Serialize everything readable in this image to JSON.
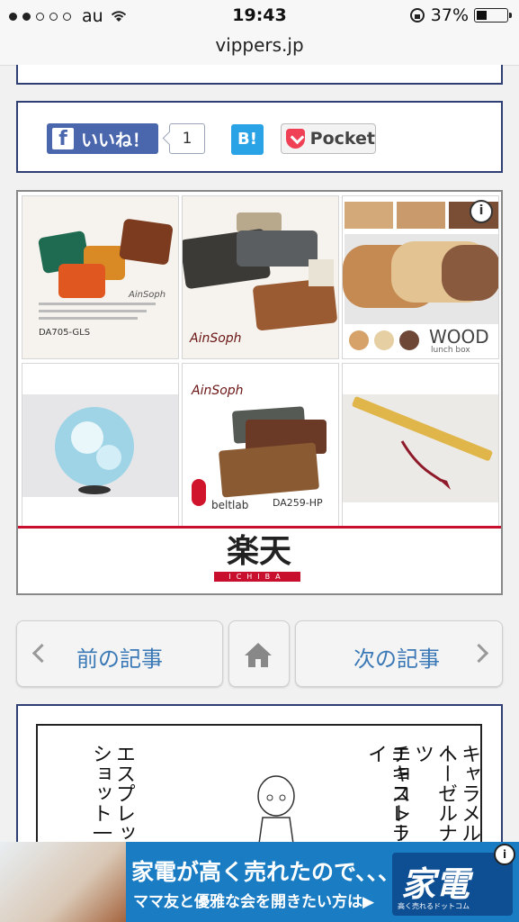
{
  "status": {
    "carrier": "au",
    "time": "19:43",
    "battery": "37%",
    "battery_level": 0.37
  },
  "url": "vippers.jp",
  "share": {
    "fb_label": "いいね！",
    "fb_count": "1",
    "hatena_label": "B!",
    "pocket_label": "Pocket"
  },
  "ads": {
    "items": [
      {
        "caption": "DA705-GLS",
        "brand": "AinSoph"
      },
      {
        "brand": "AinSoph"
      },
      {
        "title": "WOOD",
        "subtitle": "lunch box"
      },
      {},
      {
        "brand": "AinSoph",
        "maker": "beltlab",
        "model": "DA259-HP"
      },
      {}
    ],
    "store": {
      "name": "楽天",
      "sub": "ICHIBA"
    }
  },
  "nav": {
    "prev_label": "前の記事",
    "next_label": "次の記事"
  },
  "comic": {
    "col1": "キャラメルソー",
    "col2": "ヘーゼルナッツ",
    "col3": "チョコレート",
    "col4": "エキストラホイ",
    "col5": "エスプレッソ",
    "col6": "ショット一杯"
  },
  "banner": {
    "headline": "家電が高く売れたので、、、",
    "sub": "ママ友と優雅な会を開きたい方は▶",
    "logo": "家電",
    "logo_sub": "高く売れるドットコム"
  }
}
